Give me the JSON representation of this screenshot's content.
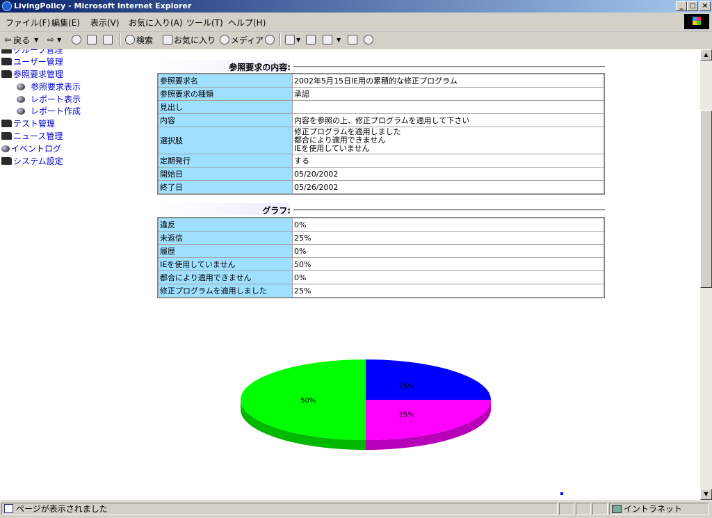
{
  "window": {
    "title": "LivingPolicy - Microsoft Internet Explorer"
  },
  "menu": [
    "ファイル(F)",
    "編集(E)",
    "表示(V)",
    "お気に入り(A)",
    "ツール(T)",
    "ヘルプ(H)"
  ],
  "toolbar": {
    "back": "戻る",
    "search": "検索",
    "favorites": "お気に入り",
    "media": "メディア"
  },
  "nav": {
    "cut_item": "グループ管理",
    "user_mgmt": "ユーザー管理",
    "ref_mgmt": "参照要求管理",
    "ref_view": "参照要求表示",
    "report_view": "レポート表示",
    "report_create": "レポート作成",
    "test_mgmt": "テスト管理",
    "news_mgmt": "ニュース管理",
    "event_log": "イベントログ",
    "system_settings": "システム設定"
  },
  "request": {
    "section_title": "参照要求の内容:",
    "rows": [
      {
        "k": "参照要求名",
        "v": "2002年5月15日IE用の累積的な修正プログラム"
      },
      {
        "k": "参照要求の種類",
        "v": "承認"
      },
      {
        "k": "見出し",
        "v": ""
      },
      {
        "k": "内容",
        "v": "内容を参照の上、修正プログラムを適用して下さい"
      },
      {
        "k": "選択肢",
        "v1": "修正プログラムを適用しました",
        "v2": "都合により適用できません",
        "v3": "IEを使用していません"
      },
      {
        "k": "定期発行",
        "v": "する"
      },
      {
        "k": "開始日",
        "v": "05/20/2002"
      },
      {
        "k": "終了日",
        "v": "05/26/2002"
      }
    ]
  },
  "graph": {
    "section_title": "グラフ:",
    "rows": [
      {
        "k": "違反",
        "v": "0%"
      },
      {
        "k": "未返信",
        "v": "25%"
      },
      {
        "k": "履歴",
        "v": "0%"
      },
      {
        "k": "IEを使用していません",
        "v": "50%"
      },
      {
        "k": "都合により適用できません",
        "v": "0%"
      },
      {
        "k": "修正プログラムを適用しました",
        "v": "25%"
      }
    ]
  },
  "chart_data": {
    "type": "pie",
    "slices": [
      {
        "label": "25%",
        "value": 25,
        "color": "#0000ff"
      },
      {
        "label": "25%",
        "value": 25,
        "color": "#ff00ff"
      },
      {
        "label": "50%",
        "value": 50,
        "color": "#00ff00"
      }
    ]
  },
  "status": {
    "text": "ページが表示されました",
    "zone": "イントラネット"
  }
}
